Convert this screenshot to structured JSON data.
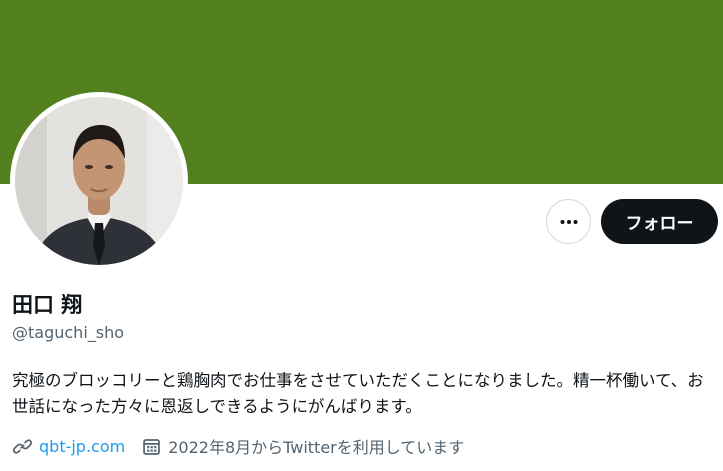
{
  "colors": {
    "banner": "#53801f",
    "follow_button_bg": "#0f1419",
    "link": "#1d9bf0",
    "secondary_text": "#536471"
  },
  "profile": {
    "display_name": "田口 翔",
    "handle": "@taguchi_sho",
    "bio": "究極のブロッコリーと鶏胸肉でお仕事をさせていただくことになりました。精一杯働いて、お世話になった方々に恩返しできるようにがんばります。",
    "website": "qbt-jp.com",
    "joined": "2022年8月からTwitterを利用しています"
  },
  "actions": {
    "follow_label": "フォロー",
    "more_icon": "more-horizontal-icon"
  },
  "icons": {
    "website": "link-icon",
    "joined": "calendar-icon"
  }
}
